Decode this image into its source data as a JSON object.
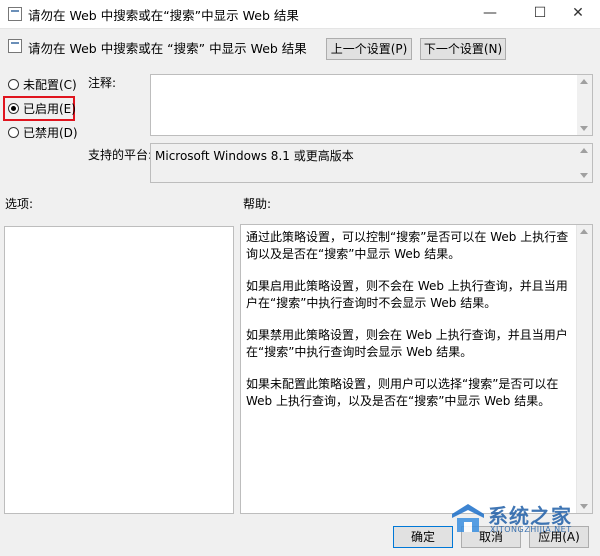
{
  "window": {
    "title": "请勿在 Web 中搜索或在“搜索”中显示 Web 结果",
    "minimize_glyph": "—",
    "maximize_glyph": "☐",
    "close_glyph": "✕"
  },
  "header": {
    "title": "请勿在 Web 中搜索或在 “搜索” 中显示 Web 结果",
    "prev_button": "上一个设置(P)",
    "next_button": "下一个设置(N)"
  },
  "radios": [
    {
      "label": "未配置(C)",
      "checked": false
    },
    {
      "label": "已启用(E)",
      "checked": true
    },
    {
      "label": "已禁用(D)",
      "checked": false
    }
  ],
  "comment": {
    "label": "注释:",
    "value": ""
  },
  "platform": {
    "label": "支持的平台:",
    "value": "Microsoft Windows 8.1 或更高版本"
  },
  "options_label": "选项:",
  "help": {
    "label": "帮助:",
    "paragraphs": [
      "通过此策略设置，可以控制“搜索”是否可以在 Web 上执行查询以及是否在“搜索”中显示 Web 结果。",
      "如果启用此策略设置，则不会在 Web 上执行查询，并且当用户在“搜索”中执行查询时不会显示 Web 结果。",
      "如果禁用此策略设置，则会在 Web 上执行查询，并且当用户在“搜索”中执行查询时会显示 Web 结果。",
      "如果未配置此策略设置，则用户可以选择“搜索”是否可以在 Web 上执行查询，以及是否在“搜索”中显示 Web 结果。"
    ]
  },
  "footer": {
    "ok": "确定",
    "cancel": "取消",
    "apply": "应用(A)"
  },
  "watermark": {
    "brand": "系统之家",
    "sub": "XITONGZHIJIA.NET"
  },
  "colors": {
    "highlight": "#e0141e",
    "accent": "#0078d7"
  }
}
